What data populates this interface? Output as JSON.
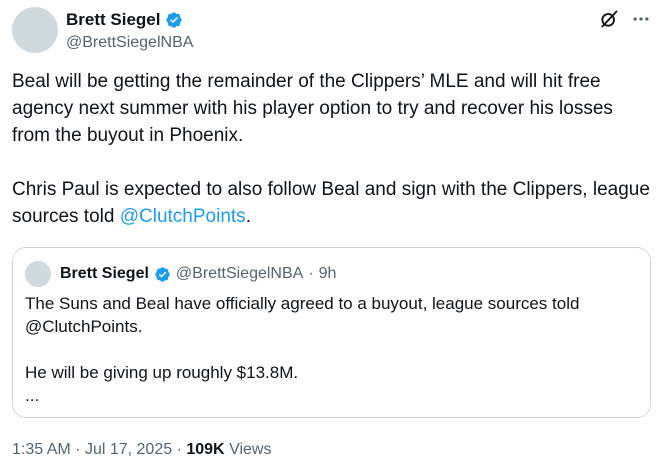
{
  "author": {
    "name": "Brett Siegel",
    "handle": "@BrettSiegelNBA"
  },
  "tweet": {
    "paragraph1": "Beal will be getting the remainder of the Clippers’ MLE and will hit free agency next summer with his player option to try and recover his losses from the buyout in Phoenix.",
    "paragraph2_text": "Chris Paul is expected to also follow Beal and sign with the Clippers, league sources told ",
    "paragraph2_mention": "@ClutchPoints",
    "paragraph2_end": "."
  },
  "quoted_tweet": {
    "name": "Brett Siegel",
    "handle": "@BrettSiegelNBA",
    "separator": "·",
    "time": "9h",
    "line1": "The Suns and Beal have officially agreed to a buyout, league sources told",
    "line2": "@ClutchPoints.",
    "line3": "He will be giving up roughly $13.8M.",
    "line4": "..."
  },
  "meta": {
    "time": "1:35 AM",
    "separator1": "·",
    "date": "Jul 17, 2025",
    "separator2": "·",
    "views_count": "109K",
    "views_label": "Views"
  },
  "icons": {
    "verified": "verified-badge-icon",
    "grok": "grok-icon",
    "more": "more-icon"
  },
  "colors": {
    "accent": "#1d9bf0",
    "text": "#0f1419",
    "secondary_text": "#536471",
    "border": "#cfd9de"
  }
}
